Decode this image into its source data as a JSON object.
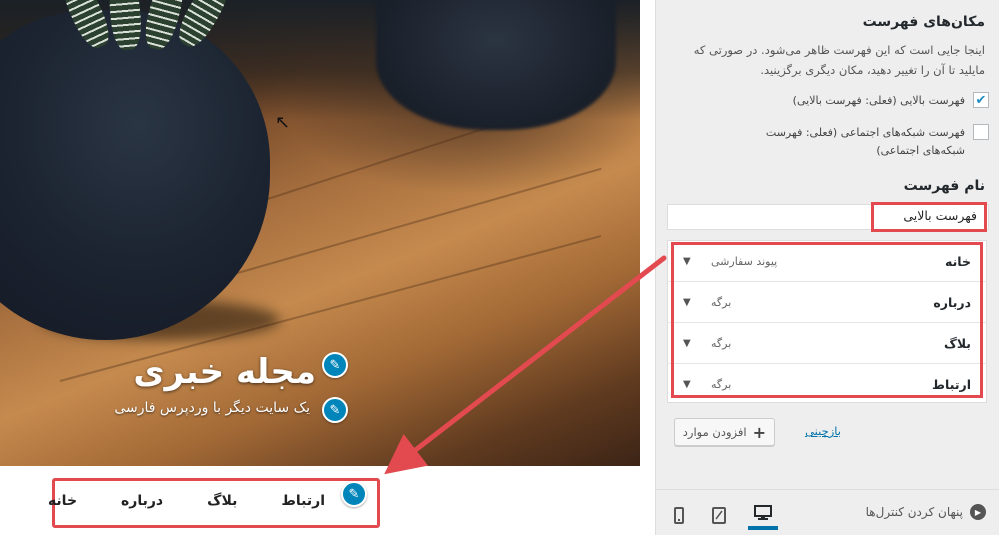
{
  "preview": {
    "site_title": "مجله خبری",
    "site_tagline": "یک سایت دیگر با وردپرس فارسی",
    "menu": [
      "خانه",
      "درباره",
      "بلاگ",
      "ارتباط"
    ]
  },
  "panel": {
    "locations_title": "مکان‌های فهرست",
    "locations_desc": "اینجا جایی است که این فهرست ظاهر می‌شود. در صورتی که مایلید تا آن را تغییر دهید، مکان دیگری برگزینید.",
    "locations": [
      {
        "label": "فهرست بالایی (فعلی: فهرست بالایی)",
        "checked": true
      },
      {
        "label": "فهرست شبکه‌های اجتماعی (فعلی: فهرست شبکه‌های اجتماعی)",
        "checked": false
      }
    ],
    "menu_name_title": "نام فهرست",
    "menu_name_value": "فهرست بالایی",
    "items": [
      {
        "title": "خانه",
        "type": "پیوند سفارشی"
      },
      {
        "title": "درباره",
        "type": "برگه"
      },
      {
        "title": "بلاگ",
        "type": "برگه"
      },
      {
        "title": "ارتباط",
        "type": "برگه"
      }
    ],
    "add_items_label": "افزودن موارد",
    "reorder_label": "بازچینی",
    "collapse_label": "پنهان کردن کنترل‌ها"
  },
  "colors": {
    "highlight": "#e24a4f",
    "accent": "#0085ba",
    "link": "#0073aa"
  }
}
